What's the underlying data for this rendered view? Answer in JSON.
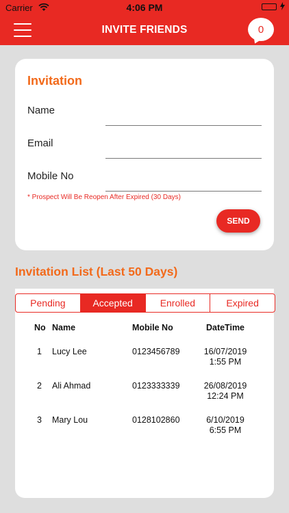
{
  "status_bar": {
    "carrier": "Carrier",
    "time": "4:06 PM",
    "battery_level": 1.0,
    "wifi_icon": "wifi-icon",
    "battery_icon": "battery-icon"
  },
  "nav": {
    "title": "INVITE FRIENDS",
    "menu_icon": "hamburger-menu-icon",
    "notification_count": "0"
  },
  "invitation": {
    "title": "Invitation",
    "fields": {
      "name_label": "Name",
      "name_value": "",
      "email_label": "Email",
      "email_value": "",
      "mobile_label": "Mobile No",
      "mobile_value": ""
    },
    "note": "* Prospect Will Be Reopen After Expired (30 Days)",
    "send_label": "SEND"
  },
  "list": {
    "title": "Invitation List (Last 50 Days)",
    "tabs": [
      "Pending",
      "Accepted",
      "Enrolled",
      "Expired"
    ],
    "active_tab": "Accepted",
    "columns": {
      "no": "No",
      "name": "Name",
      "mobile": "Mobile No",
      "datetime": "DateTime"
    },
    "rows": [
      {
        "no": "1",
        "name": "Lucy Lee",
        "mobile": "0123456789",
        "date": "16/07/2019",
        "time": "1:55 PM"
      },
      {
        "no": "2",
        "name": "Ali Ahmad",
        "mobile": "0123333339",
        "date": "26/08/2019",
        "time": "12:24 PM"
      },
      {
        "no": "3",
        "name": "Mary Lou",
        "mobile": "0128102860",
        "date": "6/10/2019",
        "time": "6:55 PM"
      }
    ]
  },
  "colors": {
    "brand_red": "#e82923",
    "accent_orange": "#f26a1b",
    "background": "#dedede"
  }
}
